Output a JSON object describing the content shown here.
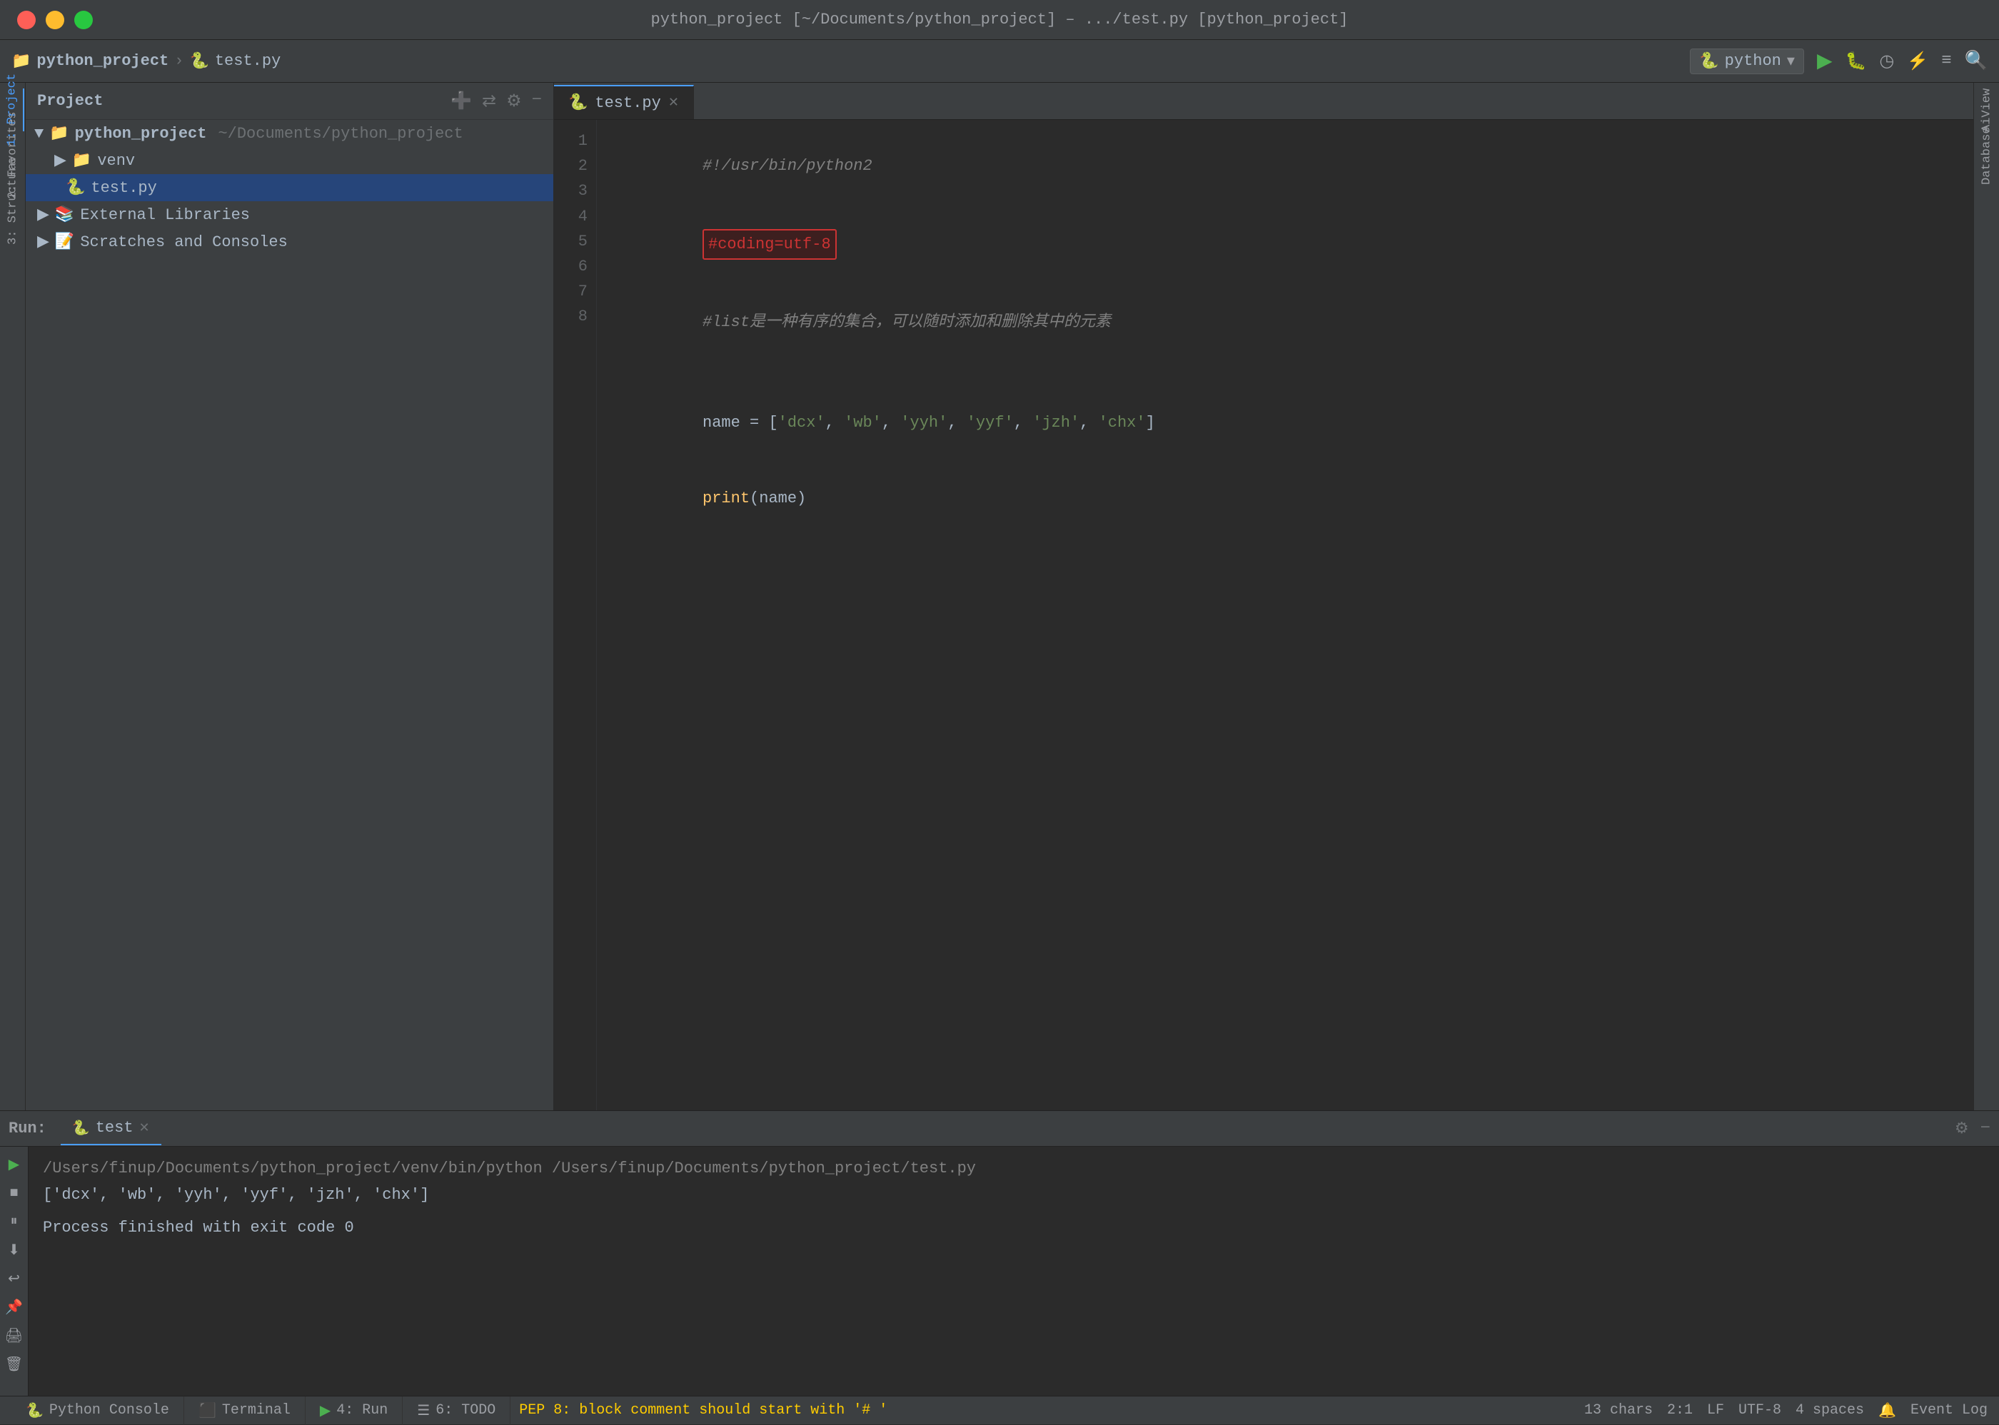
{
  "titleBar": {
    "title": "python_project [~/Documents/python_project] – .../test.py [python_project]"
  },
  "breadcrumb": {
    "project": "python_project",
    "file": "test.py"
  },
  "toolbar": {
    "runConfig": "python",
    "runLabel": "▶",
    "buildLabel": "🔨",
    "debugLabel": "🐛",
    "coverageLabel": "◷",
    "profileLabel": "⚡",
    "moreLabel": "≡",
    "searchLabel": "🔍"
  },
  "projectPanel": {
    "title": "Project",
    "items": [
      {
        "id": "python_project",
        "label": "python_project",
        "subtitle": "~/Documents/python_project",
        "type": "project",
        "expanded": true,
        "indent": 0
      },
      {
        "id": "venv",
        "label": "venv",
        "type": "folder",
        "expanded": false,
        "indent": 1
      },
      {
        "id": "test.py",
        "label": "test.py",
        "type": "pyfile",
        "indent": 1,
        "selected": true
      },
      {
        "id": "ext-libs",
        "label": "External Libraries",
        "type": "folder",
        "indent": 0,
        "expanded": false
      },
      {
        "id": "scratches",
        "label": "Scratches and Consoles",
        "type": "folder",
        "indent": 0,
        "expanded": false
      }
    ]
  },
  "editorTabs": [
    {
      "label": "test.py",
      "active": true,
      "icon": "py"
    }
  ],
  "codeLines": [
    {
      "num": 1,
      "content": "#!/usr/bin/python2",
      "type": "comment"
    },
    {
      "num": 2,
      "content": "#coding=utf-8",
      "type": "highlighted"
    },
    {
      "num": 3,
      "content": "#list是一种有序的集合，可以随时添加和删除其中的元素",
      "type": "comment"
    },
    {
      "num": 4,
      "content": "",
      "type": "normal"
    },
    {
      "num": 5,
      "content": "name = ['dcx', 'wb', 'yyh', 'yyf', 'jzh', 'chx']",
      "type": "code"
    },
    {
      "num": 6,
      "content": "print(name)",
      "type": "code"
    },
    {
      "num": 7,
      "content": "",
      "type": "normal"
    },
    {
      "num": 8,
      "content": "",
      "type": "normal"
    }
  ],
  "runPanel": {
    "label": "Run:",
    "tabName": "test",
    "cmd": "/Users/finup/Documents/python_project/venv/bin/python /Users/finup/Documents/python_project/test.py",
    "output": "['dcx', 'wb', 'yyh', 'yyf', 'jzh', 'chx']",
    "exit": "Process finished with exit code 0"
  },
  "statusBar": {
    "pythonConsole": "Python Console",
    "terminal": "Terminal",
    "run": "4: Run",
    "todo": "6: TODO",
    "warning": "PEP 8: block comment should start with '# '",
    "chars": "13 chars",
    "pos": "2:1",
    "lf": "LF",
    "encoding": "UTF-8",
    "indent": "4 spaces",
    "eventLog": "Event Log"
  },
  "rightSidebar": {
    "items": [
      "AiView",
      "Database"
    ]
  },
  "leftSidebarItems": [
    {
      "label": "1: Project"
    },
    {
      "label": "2: Favorites"
    },
    {
      "label": "3: Structure"
    }
  ]
}
